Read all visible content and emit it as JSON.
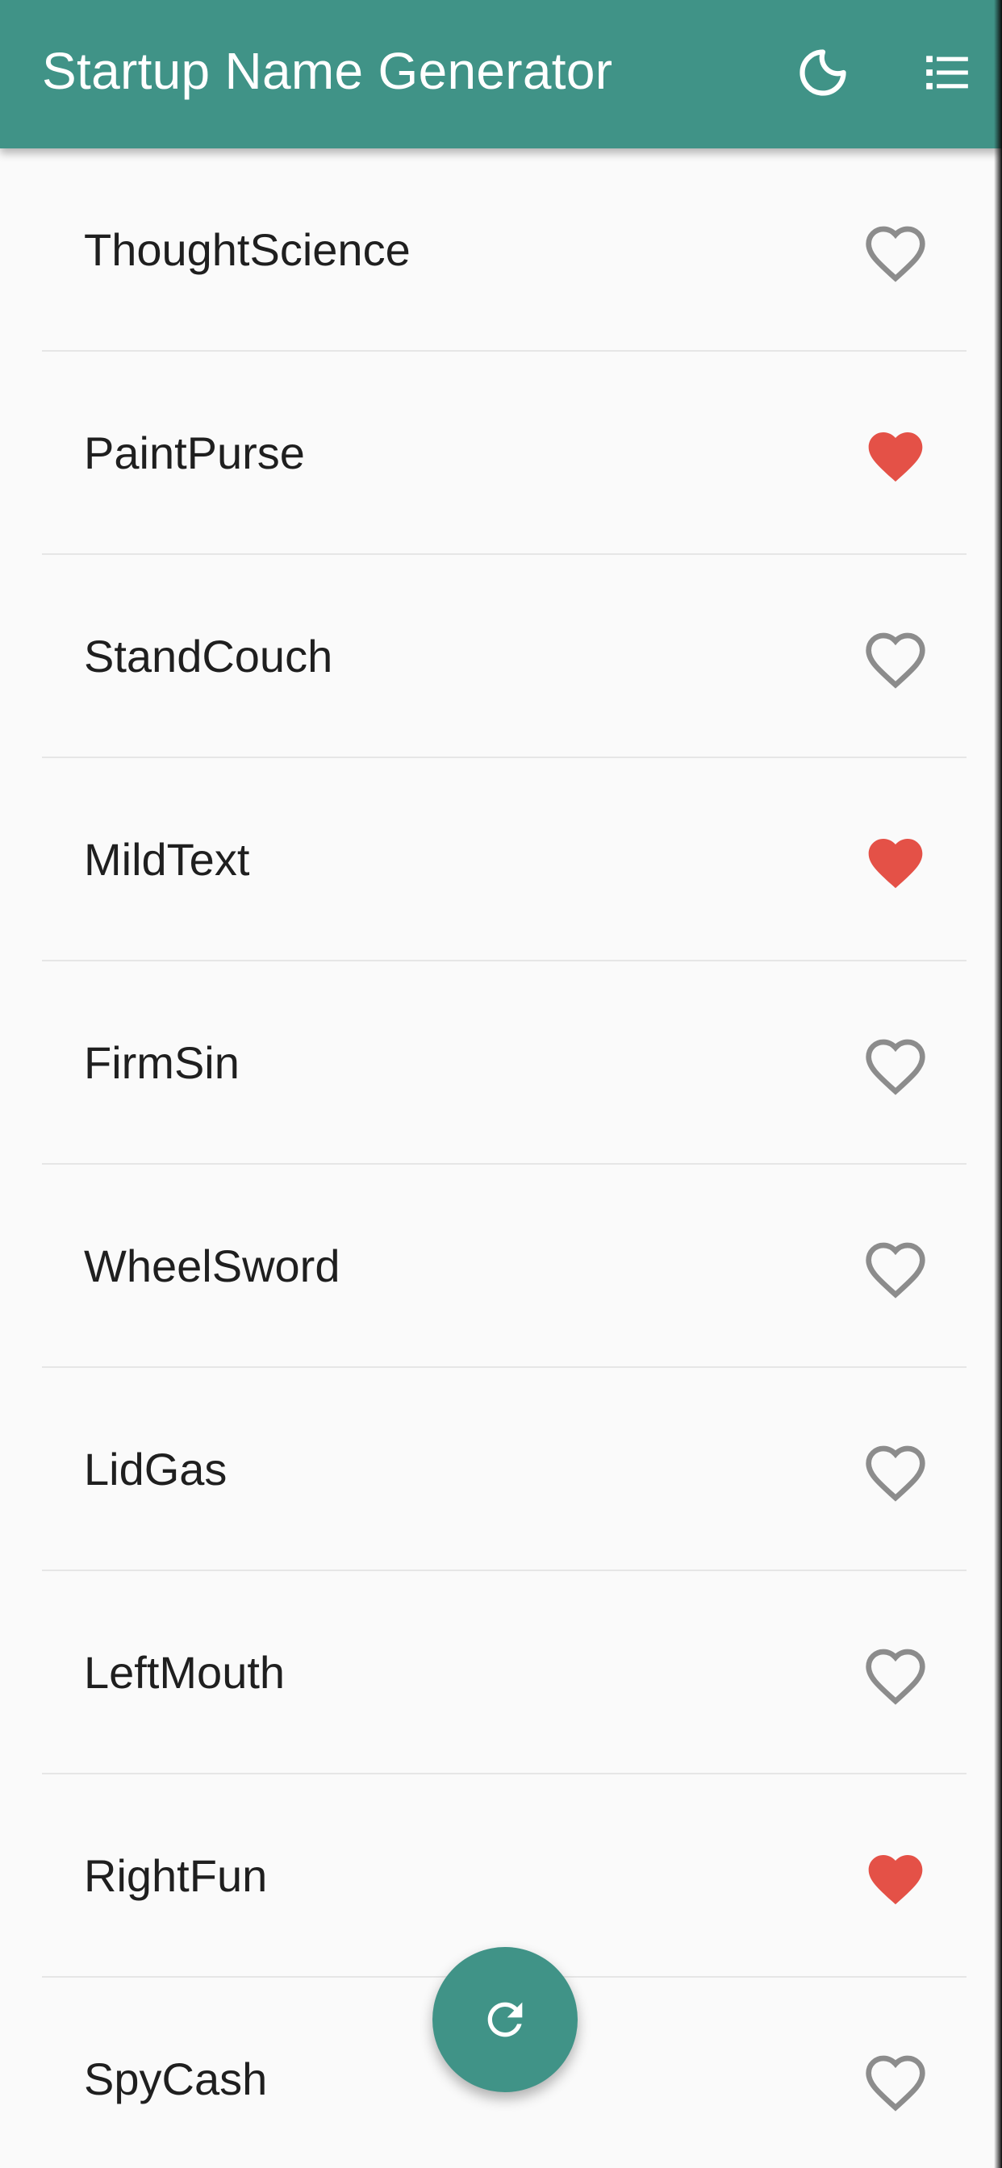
{
  "appbar": {
    "title": "Startup Name Generator",
    "background_color": "#409387",
    "actions": [
      {
        "icon": "moon-icon",
        "purpose": "toggle theme"
      },
      {
        "icon": "list-icon",
        "purpose": "saved suggestions"
      }
    ]
  },
  "colors": {
    "heart_filled": "#e45147",
    "heart_outline": "#8c8c8c",
    "text": "#1f1f1f",
    "divider": "#e6e6e6",
    "background": "#fafafa"
  },
  "suggestions": [
    {
      "name": "ThoughtScience",
      "saved": false
    },
    {
      "name": "PaintPurse",
      "saved": true
    },
    {
      "name": "StandCouch",
      "saved": false
    },
    {
      "name": "MildText",
      "saved": true
    },
    {
      "name": "FirmSin",
      "saved": false
    },
    {
      "name": "WheelSword",
      "saved": false
    },
    {
      "name": "LidGas",
      "saved": false
    },
    {
      "name": "LeftMouth",
      "saved": false
    },
    {
      "name": "RightFun",
      "saved": true
    },
    {
      "name": "SpyCash",
      "saved": false
    }
  ],
  "fab": {
    "icon": "refresh-icon"
  }
}
